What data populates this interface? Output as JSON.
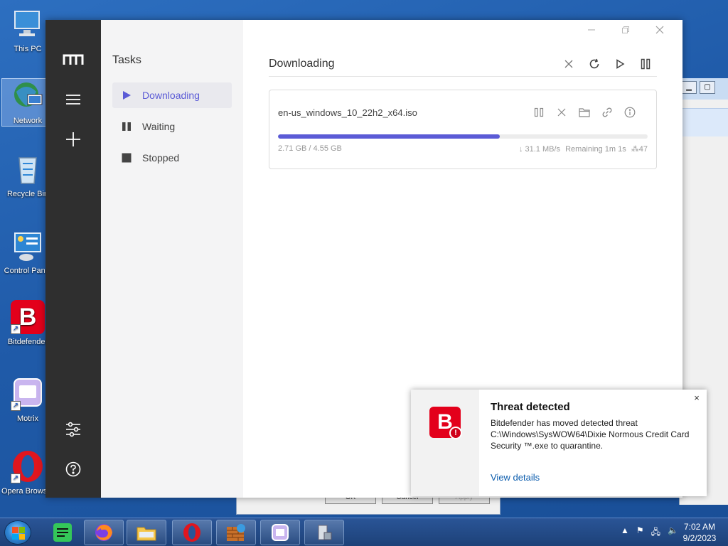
{
  "desktop": {
    "icons": [
      {
        "label": "This PC",
        "icon": "computer-icon"
      },
      {
        "label": "Network",
        "icon": "network-globe-icon"
      },
      {
        "label": "Recycle Bin",
        "icon": "recycle-bin-icon"
      },
      {
        "label": "Control Panel",
        "icon": "control-panel-icon"
      },
      {
        "label": "Bitdefender",
        "icon": "bitdefender-icon"
      },
      {
        "label": "Motrix",
        "icon": "motrix-icon"
      },
      {
        "label": "Opera Browser",
        "icon": "opera-icon"
      }
    ]
  },
  "background_dialog": {
    "buttons": [
      "OK",
      "Cancel",
      "Apply"
    ]
  },
  "motrix": {
    "sidebar_title": "Tasks",
    "menu": [
      {
        "label": "Downloading",
        "icon": "play-icon",
        "active": true
      },
      {
        "label": "Waiting",
        "icon": "pause-icon",
        "active": false
      },
      {
        "label": "Stopped",
        "icon": "stop-icon",
        "active": false
      }
    ],
    "header_title": "Downloading",
    "task": {
      "filename": "en-us_windows_10_22h2_x64.iso",
      "progress_fraction": 0.6,
      "size_text": "2.71 GB / 4.55 GB",
      "speed": "↓ 31.1 MB/s",
      "remaining": "Remaining 1m 1s",
      "connections": "47"
    }
  },
  "notification": {
    "title": "Threat detected",
    "message": "Bitdefender has moved detected threat C:\\Windows\\SysWOW64\\Dixie Normous Credit Card Security ™.exe to quarantine.",
    "link": "View details",
    "close": "×"
  },
  "taskbar": {
    "apps": [
      "spotify-icon",
      "firefox-icon",
      "file-explorer-icon",
      "opera-icon",
      "firewall-icon",
      "motrix-icon",
      "device-icon"
    ],
    "time": "7:02 AM",
    "date": "9/2/2023"
  },
  "colors": {
    "accent": "#5b5bd6",
    "rail": "#2f2f2f",
    "bitdefender_red": "#e3001b"
  }
}
